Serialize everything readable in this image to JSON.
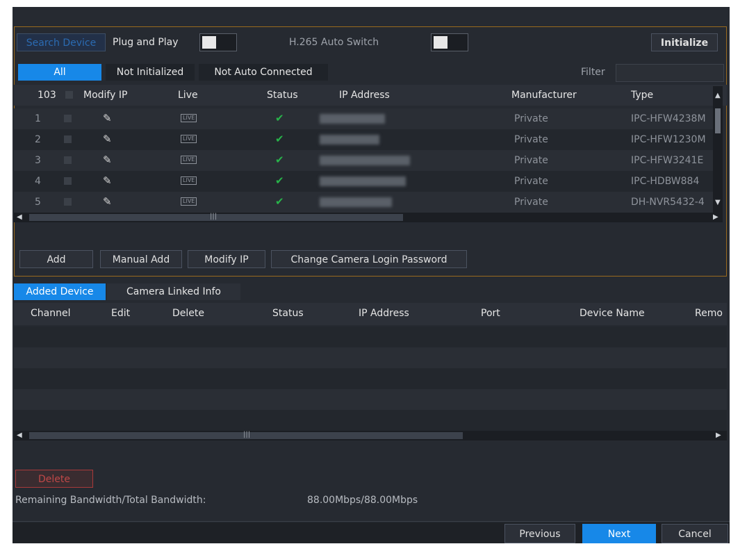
{
  "top": {
    "search_device_label": "Search Device",
    "plug_and_play_label": "Plug and Play",
    "h265_label": "H.265 Auto Switch",
    "initialize_label": "Initialize"
  },
  "filter_tabs": {
    "all": "All",
    "not_initialized": "Not Initialized",
    "not_auto_connected": "Not Auto Connected",
    "filter_label": "Filter"
  },
  "device_table": {
    "headers": {
      "count": "103",
      "modify_ip": "Modify IP",
      "live": "Live",
      "status": "Status",
      "ip_address": "IP Address",
      "manufacturer": "Manufacturer",
      "type": "Type"
    },
    "live_badge": "LIVE",
    "rows": [
      {
        "num": "1",
        "manufacturer": "Private",
        "type": "IPC-HFW4238M"
      },
      {
        "num": "2",
        "manufacturer": "Private",
        "type": "IPC-HFW1230M"
      },
      {
        "num": "3",
        "manufacturer": "Private",
        "type": "IPC-HFW3241E"
      },
      {
        "num": "4",
        "manufacturer": "Private",
        "type": "IPC-HDBW884"
      },
      {
        "num": "5",
        "manufacturer": "Private",
        "type": "DH-NVR5432-4"
      }
    ]
  },
  "actions": {
    "add": "Add",
    "manual_add": "Manual Add",
    "modify_ip": "Modify IP",
    "change_password": "Change Camera Login Password"
  },
  "lower_tabs": {
    "added_device": "Added Device",
    "camera_linked_info": "Camera Linked Info"
  },
  "added_table": {
    "headers": {
      "channel": "Channel",
      "edit": "Edit",
      "delete": "Delete",
      "status": "Status",
      "ip_address": "IP Address",
      "port": "Port",
      "device_name": "Device Name",
      "remote": "Remo"
    }
  },
  "delete_label": "Delete",
  "bandwidth": {
    "label": "Remaining Bandwidth/Total Bandwidth:",
    "value": "88.00Mbps/88.00Mbps"
  },
  "footer": {
    "previous": "Previous",
    "next": "Next",
    "cancel": "Cancel"
  },
  "colors": {
    "accent": "#1788e8",
    "status_ok": "#28b44a",
    "panel": "#262a31",
    "highlight_border": "#9a6a1e"
  }
}
